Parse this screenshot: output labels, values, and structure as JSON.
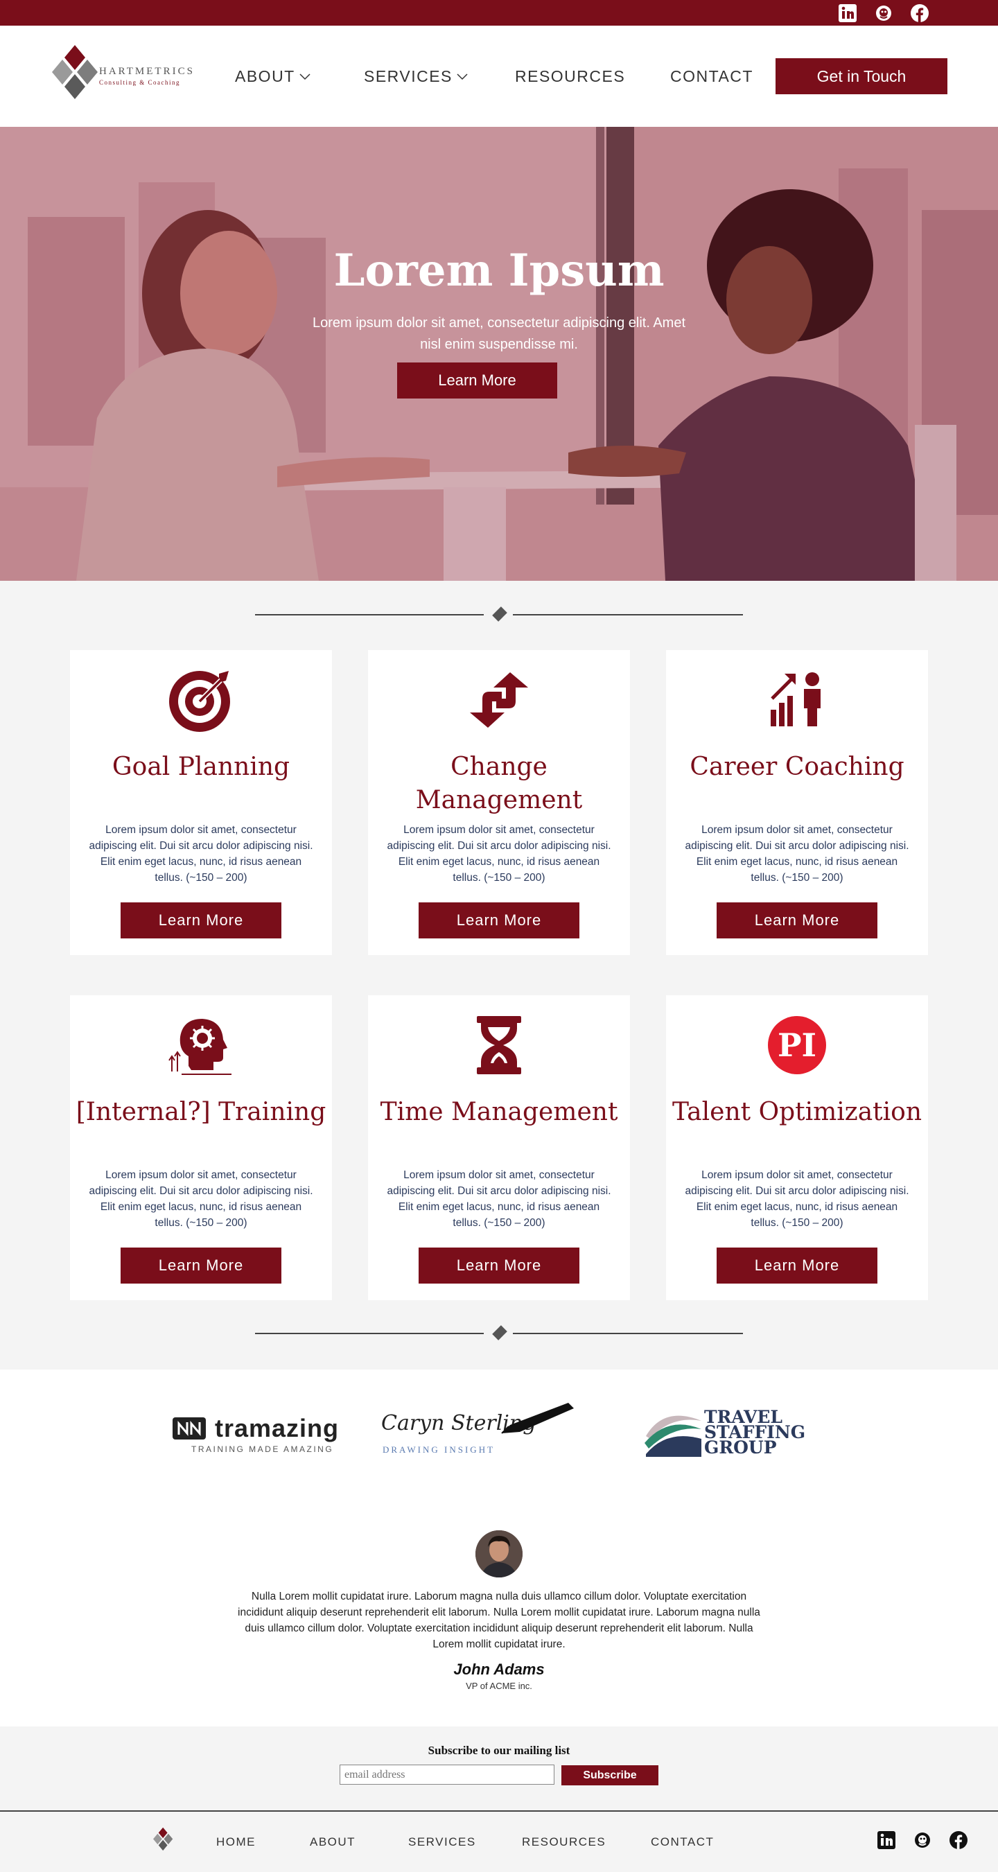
{
  "brand": {
    "name": "HARTMETRICS",
    "tagline": "Consulting & Coaching",
    "maroon": "#7a0e1a"
  },
  "social": [
    {
      "name": "linkedin-icon"
    },
    {
      "name": "mailchimp-icon"
    },
    {
      "name": "facebook-icon"
    }
  ],
  "nav": {
    "about": "ABOUT",
    "services": "SERVICES",
    "resources": "RESOURCES",
    "contact": "CONTACT",
    "cta": "Get in Touch"
  },
  "hero": {
    "title": "Lorem Ipsum",
    "text": "Lorem ipsum dolor sit amet, consectetur adipiscing elit. Amet nisl enim suspendisse mi.",
    "button": "Learn More"
  },
  "services": [
    {
      "title": "Goal Planning",
      "text": "Lorem ipsum dolor sit amet, consectetur adipiscing elit. Dui sit arcu dolor adipiscing nisi. Elit enim eget lacus, nunc, id risus aenean tellus. (~150 – 200)",
      "button": "Learn More",
      "icon": "target-icon"
    },
    {
      "title": "Change Management",
      "text": "Lorem ipsum dolor sit amet, consectetur adipiscing elit. Dui sit arcu dolor adipiscing nisi. Elit enim eget lacus, nunc, id risus aenean tellus. (~150 – 200)",
      "button": "Learn More",
      "icon": "change-arrows-icon"
    },
    {
      "title": "Career Coaching",
      "text": "Lorem ipsum dolor sit amet, consectetur adipiscing elit. Dui sit arcu dolor adipiscing nisi. Elit enim eget lacus, nunc, id risus aenean tellus. (~150 – 200)",
      "button": "Learn More",
      "icon": "career-growth-icon"
    },
    {
      "title": "[Internal?] Training",
      "text": "Lorem ipsum dolor sit amet, consectetur adipiscing elit. Dui sit arcu dolor adipiscing nisi. Elit enim eget lacus, nunc, id risus aenean tellus. (~150 – 200)",
      "button": "Learn More",
      "icon": "head-gear-icon"
    },
    {
      "title": "Time Management",
      "text": "Lorem ipsum dolor sit amet, consectetur adipiscing elit. Dui sit arcu dolor adipiscing nisi. Elit enim eget lacus, nunc, id risus aenean tellus. (~150 – 200)",
      "button": "Learn More",
      "icon": "hourglass-icon"
    },
    {
      "title": "Talent Optimization",
      "text": "Lorem ipsum dolor sit amet, consectetur adipiscing elit. Dui sit arcu dolor adipiscing nisi. Elit enim eget lacus, nunc, id risus aenean tellus. (~150 – 200)",
      "button": "Learn More",
      "icon": "pi-logo-icon",
      "icon_text": "PI"
    }
  ],
  "clients": {
    "tramazing": {
      "name": "tramazing",
      "tagline": "TRAINING MADE AMAZING"
    },
    "caryn": {
      "name": "Caryn Sterling",
      "tagline": "DRAWING INSIGHT"
    },
    "travel": {
      "line1": "TRAVEL",
      "line2": "STAFFING",
      "line3": "GROUP"
    }
  },
  "testimonial": {
    "quote": "Nulla Lorem mollit cupidatat irure. Laborum magna nulla duis ullamco cillum dolor. Voluptate exercitation incididunt aliquip deserunt reprehenderit elit laborum. Nulla Lorem mollit cupidatat irure. Laborum magna nulla duis ullamco cillum dolor. Voluptate exercitation incididunt aliquip deserunt reprehenderit elit laborum. Nulla Lorem mollit cupidatat irure.",
    "author": "John Adams",
    "title": "VP of ACME inc."
  },
  "mailing": {
    "title": "Subscribe to our mailing list",
    "placeholder": "email address",
    "button": "Subscribe"
  },
  "footer": {
    "home": "HOME",
    "about": "ABOUT",
    "services": "SERVICES",
    "resources": "RESOURCES",
    "contact": "CONTACT"
  }
}
